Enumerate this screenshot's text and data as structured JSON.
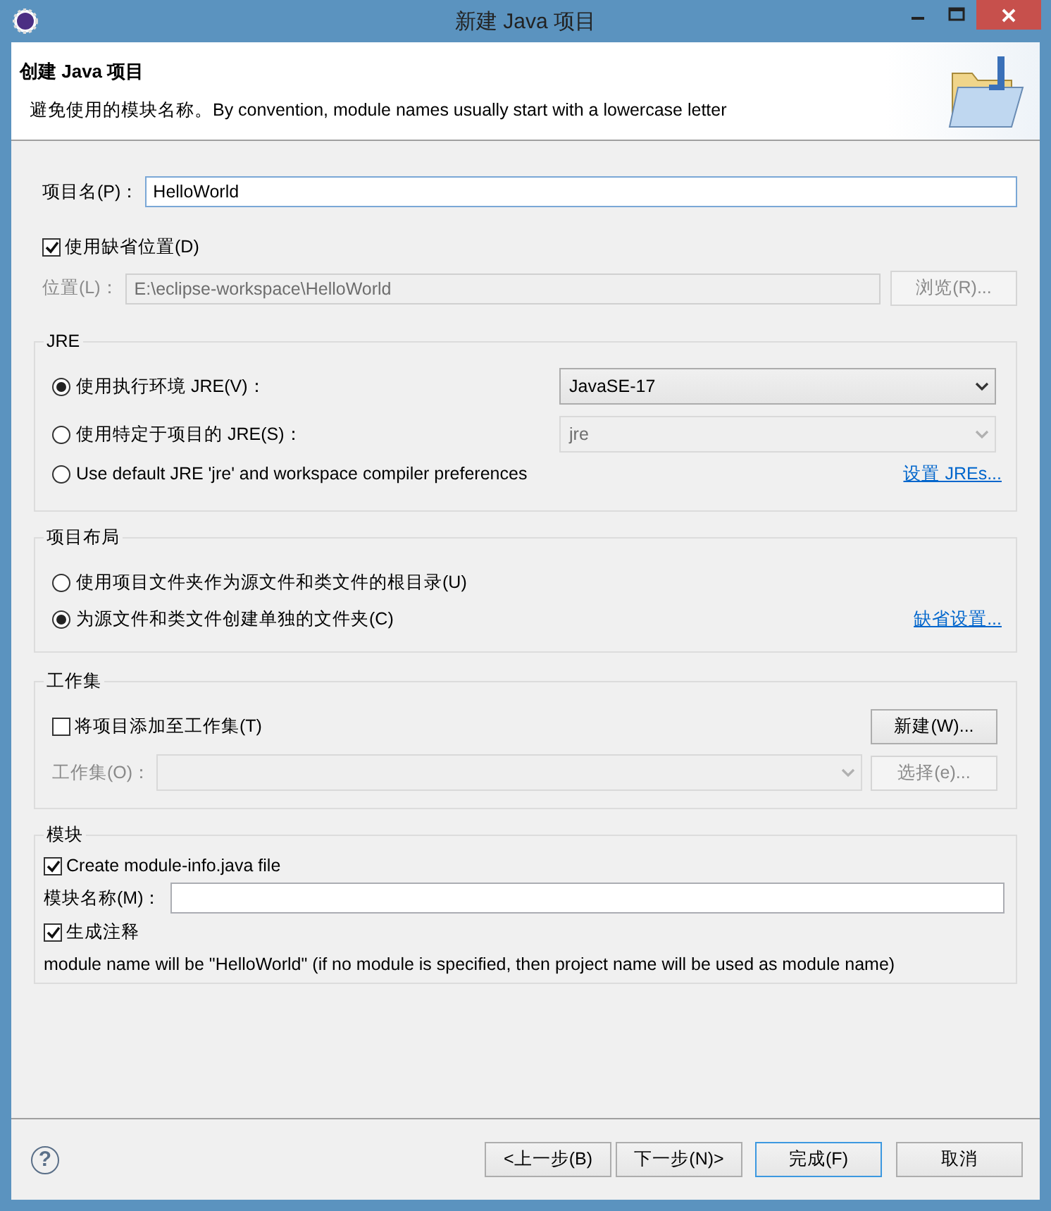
{
  "window": {
    "title": "新建 Java 项目"
  },
  "header": {
    "title": "创建 Java 项目",
    "description": "避免使用的模块名称。By convention, module names usually start with a lowercase letter"
  },
  "project_name": {
    "label": "项目名(P)：",
    "value": "HelloWorld"
  },
  "use_default_location": {
    "label": "使用缺省位置(D)",
    "checked": true
  },
  "location": {
    "label": "位置(L)：",
    "value": "E:\\eclipse-workspace\\HelloWorld",
    "disabled": true,
    "button": "浏览(R)..."
  },
  "jre": {
    "title": "JRE",
    "options": [
      {
        "label": "使用执行环境 JRE(V)：",
        "selected": true,
        "kind": "select",
        "value": "JavaSE-17",
        "disabled": false
      },
      {
        "label": "使用特定于项目的 JRE(S)：",
        "selected": false,
        "kind": "select",
        "value": "jre",
        "disabled": true
      },
      {
        "label": "Use default JRE 'jre' and workspace compiler preferences",
        "selected": false,
        "kind": "link",
        "link": "设置 JREs..."
      }
    ]
  },
  "project_layout": {
    "title": "项目布局",
    "options": [
      {
        "label": "使用项目文件夹作为源文件和类文件的根目录(U)",
        "selected": false,
        "kind": "plain"
      },
      {
        "label": "为源文件和类文件创建单独的文件夹(C)",
        "selected": true,
        "kind": "link",
        "link": "缺省设置..."
      }
    ]
  },
  "working_sets": {
    "title": "工作集",
    "add": {
      "label": "将项目添加至工作集(T)",
      "checked": false
    },
    "new_button": "新建(W)...",
    "sets_label": "工作集(O)：",
    "disabled": true,
    "select_button": "选择(e)..."
  },
  "module": {
    "title": "模块",
    "create": {
      "label": "Create module-info.java file",
      "checked": true
    },
    "name_label": "模块名称(M)：",
    "comments": {
      "label": "生成注释",
      "checked": true
    },
    "note": "module name will be \"HelloWorld\"  (if no module is specified, then project name will be used as module name)"
  },
  "help": "?",
  "buttons": [
    {
      "label": "<上一步(B)",
      "default": false
    },
    {
      "label": "下一步(N)>",
      "default": false
    },
    {
      "label": "完成(F)",
      "default": true
    },
    {
      "label": "取消",
      "default": false
    }
  ]
}
